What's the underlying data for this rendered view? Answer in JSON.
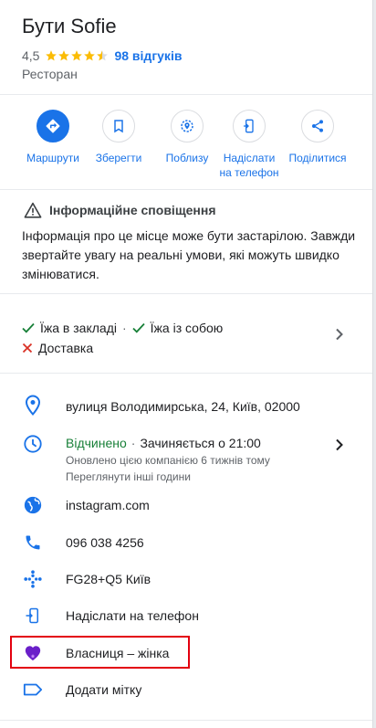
{
  "place": {
    "title": "Бути Sofie",
    "rating": "4,5",
    "stars_filled": 4.5,
    "stars_total": 5,
    "reviews_link": "98 відгуків",
    "category": "Ресторан"
  },
  "actions": [
    {
      "id": "directions",
      "label": "Маршрути",
      "icon": "directions-icon",
      "primary": true
    },
    {
      "id": "save",
      "label": "Зберегти",
      "icon": "bookmark-icon",
      "primary": false
    },
    {
      "id": "nearby",
      "label": "Поблизу",
      "icon": "nearby-icon",
      "primary": false
    },
    {
      "id": "send-to-phone",
      "label": "Надіслати на телефон",
      "icon": "phone-send-icon",
      "primary": false
    },
    {
      "id": "share",
      "label": "Поділитися",
      "icon": "share-icon",
      "primary": false
    }
  ],
  "notice": {
    "title": "Інформаційне сповіщення",
    "text": "Інформація про це місце може бути застарілою. Завжди звертайте увагу на реальні умови, які можуть швидко змінюватися."
  },
  "services": {
    "dine_in": "Їжа в закладі",
    "takeout": "Їжа із собою",
    "delivery": "Доставка",
    "separator": "·"
  },
  "info": {
    "address": "вулиця Володимирська, 24, Київ, 02000",
    "hours_status": "Відчинено",
    "hours_separator": "·",
    "hours_next": "Зачиняється о 21:00",
    "hours_updated": "Оновлено цією компанією 6 тижнів тому",
    "hours_other": "Переглянути інші години",
    "website": "instagram.com",
    "phone": "096 038 4256",
    "plus_code": "FG28+Q5 Київ",
    "send_to_phone": "Надіслати на телефон",
    "owner_attribute": "Власниця – жінка",
    "add_label": "Додати мітку"
  },
  "colors": {
    "accent": "#1a73e8",
    "open": "#188038",
    "star": "#fbbc04",
    "check": "#188038",
    "cross": "#d93025",
    "highlight": "#e3000f",
    "heart": "#6a1fc9"
  }
}
